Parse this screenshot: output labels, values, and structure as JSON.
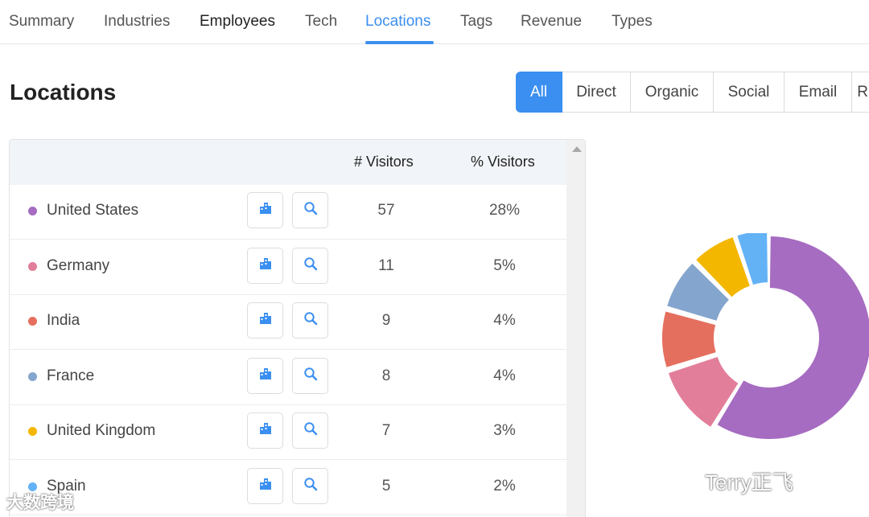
{
  "tabs": [
    {
      "label": "Summary"
    },
    {
      "label": "Industries"
    },
    {
      "label": "Employees"
    },
    {
      "label": "Tech"
    },
    {
      "label": "Locations"
    },
    {
      "label": "Tags"
    },
    {
      "label": "Revenue"
    },
    {
      "label": "Types"
    }
  ],
  "active_tab": "Locations",
  "page_title": "Locations",
  "filters": [
    {
      "label": "All"
    },
    {
      "label": "Direct"
    },
    {
      "label": "Organic"
    },
    {
      "label": "Social"
    },
    {
      "label": "Email"
    },
    {
      "label": "R"
    }
  ],
  "active_filter": "All",
  "table": {
    "headers": {
      "visitors": "# Visitors",
      "percent": "% Visitors"
    },
    "rows": [
      {
        "country": "United States",
        "visitors": "57",
        "percent": "28%",
        "color": "#a66cc1"
      },
      {
        "country": "Germany",
        "visitors": "11",
        "percent": "5%",
        "color": "#e27e99"
      },
      {
        "country": "India",
        "visitors": "9",
        "percent": "4%",
        "color": "#e56f5e"
      },
      {
        "country": "France",
        "visitors": "8",
        "percent": "4%",
        "color": "#84a5cd"
      },
      {
        "country": "United Kingdom",
        "visitors": "7",
        "percent": "3%",
        "color": "#f3b700"
      },
      {
        "country": "Spain",
        "visitors": "5",
        "percent": "2%",
        "color": "#64b2f6"
      }
    ]
  },
  "donut": {
    "segments": [
      {
        "name": "United States",
        "value": 57,
        "color": "#a66cc1"
      },
      {
        "name": "Germany",
        "value": 11,
        "color": "#e27e99"
      },
      {
        "name": "India",
        "value": 9,
        "color": "#e56f5e"
      },
      {
        "name": "France",
        "value": 8,
        "color": "#84a5cd"
      },
      {
        "name": "United Kingdom",
        "value": 7,
        "color": "#f3b700"
      },
      {
        "name": "Spain",
        "value": 5,
        "color": "#64b2f6"
      }
    ]
  },
  "watermarks": {
    "left": "大数跨境",
    "right": "Terry正飞"
  },
  "icons": {
    "row_button_1": "building-icon",
    "row_button_2": "search-icon"
  }
}
